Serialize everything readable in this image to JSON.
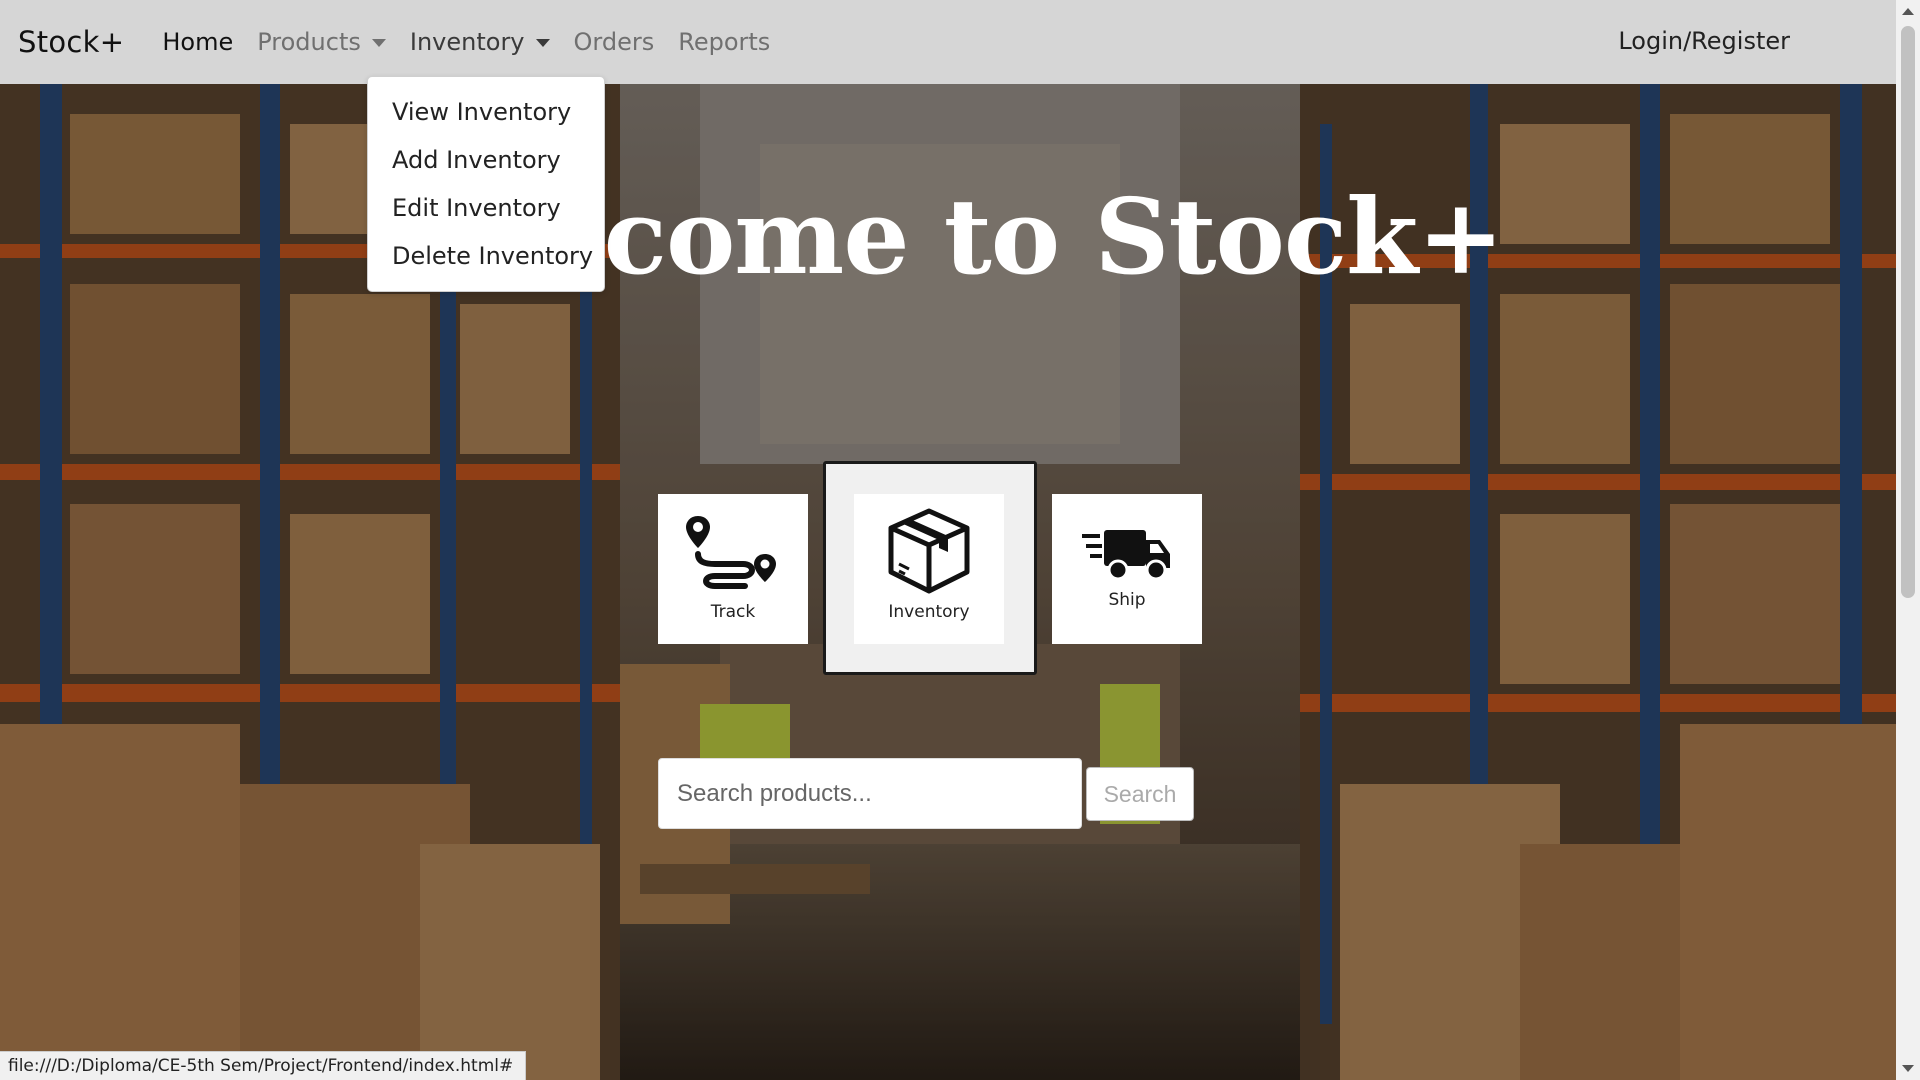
{
  "navbar": {
    "brand": "Stock+",
    "links": [
      {
        "label": "Home"
      },
      {
        "label": "Products"
      },
      {
        "label": "Inventory"
      },
      {
        "label": "Orders"
      },
      {
        "label": "Reports"
      }
    ],
    "login": "Login/Register"
  },
  "inventory_menu": {
    "items": [
      "View Inventory",
      "Add Inventory",
      "Edit Inventory",
      "Delete Inventory"
    ]
  },
  "hero": {
    "heading": "Welcome to Stock+"
  },
  "features": {
    "track": {
      "label": "Track",
      "icon": "route-map-pin-icon"
    },
    "inventory": {
      "label": "Inventory",
      "icon": "package-box-icon"
    },
    "ship": {
      "label": "Ship",
      "icon": "delivery-truck-icon"
    }
  },
  "search": {
    "placeholder": "Search products...",
    "button": "Search"
  },
  "status_bar": {
    "url": "file:///D:/Diploma/CE-5th Sem/Project/Frontend/index.html#"
  },
  "colors": {
    "navbar_bg": "#d6d6d6",
    "shelf_orange": "#c8561e",
    "shelf_blue": "#2a4a78",
    "box_brown": "#b0804f"
  }
}
